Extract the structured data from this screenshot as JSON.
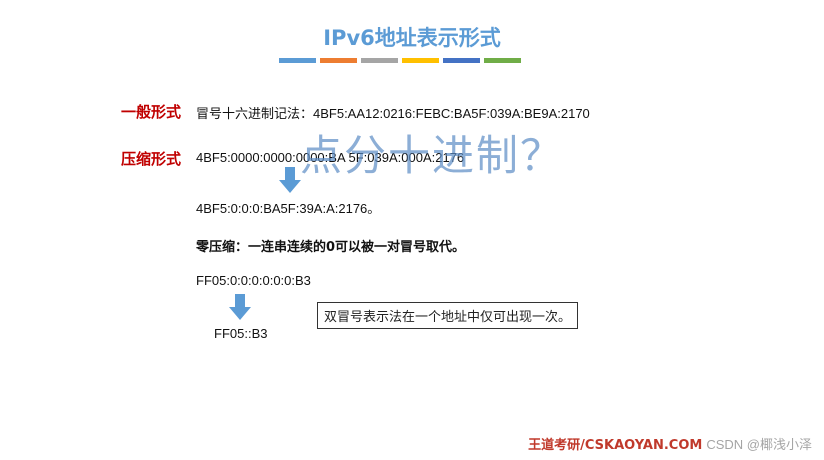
{
  "slide": {
    "title": "IPv6地址表示形式"
  },
  "color_bar": [
    "#5b9bd5",
    "#ed7d31",
    "#a5a5a5",
    "#ffc000",
    "#4472c4",
    "#70ad47"
  ],
  "general": {
    "label": "一般形式",
    "text": "冒号十六进制记法：4BF5:AA12:0216:FEBC:BA5F:039A:BE9A:2170"
  },
  "compressed": {
    "label": "压缩形式",
    "line1": "4BF5:0000:0000:0000:BA 5F:039A:000A:2176",
    "line2": "4BF5:0:0:0:BA5F:39A:A:2176。"
  },
  "overlay_text": "点分十进制？",
  "zero_compression": {
    "heading": "零压缩：一连串连续的0可以被一对冒号取代。",
    "example_full": "FF05:0:0:0:0:0:0:B3",
    "example_short": "FF05::B3",
    "note": "双冒号表示法在一个地址中仅可出现一次。"
  },
  "footer": {
    "brand": "王道考研/CSKAOYAN.COM",
    "watermark": "CSDN @椰浅小泽"
  }
}
